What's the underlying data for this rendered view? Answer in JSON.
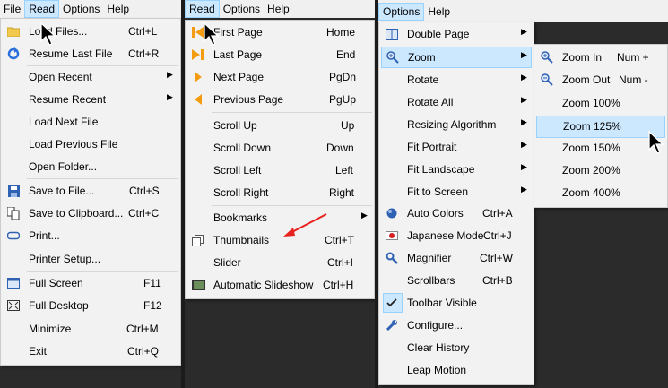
{
  "panel1": {
    "menubar": [
      "File",
      "Read",
      "Options",
      "Help"
    ],
    "items": [
      {
        "label": "Load Files...",
        "shortcut": "Ctrl+L",
        "icon": "folder-icon"
      },
      {
        "label": "Resume Last File",
        "shortcut": "Ctrl+R",
        "icon": "resume-icon"
      },
      {
        "label": "Open Recent",
        "submenu": true
      },
      {
        "label": "Resume Recent",
        "submenu": true
      },
      {
        "label": "Load Next File"
      },
      {
        "label": "Load Previous File"
      },
      {
        "label": "Open Folder..."
      },
      {
        "label": "Save to File...",
        "shortcut": "Ctrl+S",
        "icon": "save-icon"
      },
      {
        "label": "Save to Clipboard...",
        "shortcut": "Ctrl+C",
        "icon": "clipboard-icon"
      },
      {
        "label": "Print...",
        "icon": "print-icon"
      },
      {
        "label": "Printer Setup..."
      },
      {
        "label": "Full Screen",
        "shortcut": "F11",
        "icon": "fullscreen-icon"
      },
      {
        "label": "Full Desktop",
        "shortcut": "F12",
        "icon": "fulldesktop-icon"
      },
      {
        "label": "Minimize",
        "shortcut": "Ctrl+M"
      },
      {
        "label": "Exit",
        "shortcut": "Ctrl+Q"
      }
    ]
  },
  "panel2": {
    "menubar": [
      "Read",
      "Options",
      "Help"
    ],
    "items": [
      {
        "label": "First Page",
        "shortcut": "Home",
        "icon": "first-page-icon"
      },
      {
        "label": "Last Page",
        "shortcut": "End",
        "icon": "last-page-icon"
      },
      {
        "label": "Next Page",
        "shortcut": "PgDn",
        "icon": "next-page-icon"
      },
      {
        "label": "Previous Page",
        "shortcut": "PgUp",
        "icon": "previous-page-icon"
      },
      {
        "label": "Scroll Up",
        "shortcut": "Up"
      },
      {
        "label": "Scroll Down",
        "shortcut": "Down"
      },
      {
        "label": "Scroll Left",
        "shortcut": "Left"
      },
      {
        "label": "Scroll Right",
        "shortcut": "Right"
      },
      {
        "label": "Bookmarks",
        "submenu": true
      },
      {
        "label": "Thumbnails",
        "shortcut": "Ctrl+T",
        "icon": "thumbnails-icon"
      },
      {
        "label": "Slider",
        "shortcut": "Ctrl+I"
      },
      {
        "label": "Automatic Slideshow",
        "shortcut": "Ctrl+H",
        "icon": "slideshow-icon"
      }
    ]
  },
  "panel3": {
    "menubar": [
      "Options",
      "Help"
    ],
    "items": [
      {
        "label": "Double Page",
        "submenu": true,
        "icon": "double-page-icon"
      },
      {
        "label": "Zoom",
        "submenu": true,
        "icon": "zoom-icon"
      },
      {
        "label": "Rotate",
        "submenu": true
      },
      {
        "label": "Rotate All",
        "submenu": true
      },
      {
        "label": "Resizing Algorithm",
        "submenu": true
      },
      {
        "label": "Fit Portrait",
        "submenu": true
      },
      {
        "label": "Fit Landscape",
        "submenu": true
      },
      {
        "label": "Fit to Screen",
        "submenu": true
      },
      {
        "label": "Auto Colors",
        "shortcut": "Ctrl+A",
        "icon": "auto-colors-icon"
      },
      {
        "label": "Japanese Mode",
        "shortcut": "Ctrl+J",
        "icon": "japanese-mode-icon"
      },
      {
        "label": "Magnifier",
        "shortcut": "Ctrl+W",
        "icon": "magnifier-icon"
      },
      {
        "label": "Scrollbars",
        "shortcut": "Ctrl+B"
      },
      {
        "label": "Toolbar Visible",
        "checked": true
      },
      {
        "label": "Configure...",
        "icon": "wrench-icon"
      },
      {
        "label": "Clear History"
      },
      {
        "label": "Leap Motion"
      }
    ],
    "zoom_submenu": [
      {
        "label": "Zoom In",
        "shortcut": "Num +",
        "icon": "zoom-in-icon"
      },
      {
        "label": "Zoom Out",
        "shortcut": "Num -",
        "icon": "zoom-out-icon"
      },
      {
        "label": "Zoom 100%"
      },
      {
        "label": "Zoom 125%"
      },
      {
        "label": "Zoom 150%"
      },
      {
        "label": "Zoom 200%"
      },
      {
        "label": "Zoom 400%"
      }
    ]
  },
  "colors": {
    "highlight": "#cce8ff",
    "highlight_border": "#99d1ff",
    "menu_bg": "#f2f2f2",
    "arrow": "#e8221f"
  }
}
